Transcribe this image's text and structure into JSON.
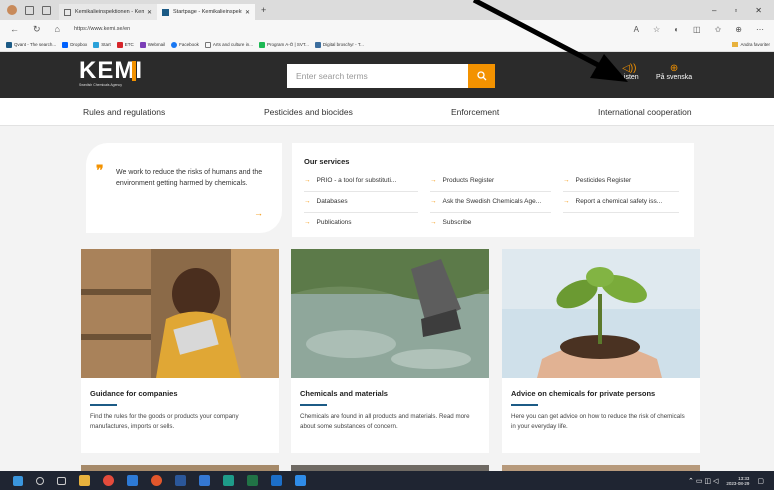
{
  "browser": {
    "tabs": [
      {
        "title": "Kemikalieinspektionen - Kemikal",
        "active": false
      },
      {
        "title": "Startpage - Kemikalieinspektion",
        "active": true
      }
    ],
    "url": "https://www.kemi.se/en",
    "favorites": [
      "Qvant - The search...",
      "Dropbox",
      "Start",
      "ETC",
      "Webmail",
      "Facebook",
      "Arts and culture in...",
      "Program A-Ö | SVT...",
      "Digital broschyr - T..."
    ],
    "favorites_other": "Andra favoriter"
  },
  "header": {
    "logo": "KEMI",
    "logo_sub": "Swedish Chemicals Agency",
    "search_placeholder": "Enter search terms",
    "listen_label": "Listen",
    "language_label": "På svenska"
  },
  "nav": [
    "Rules and regulations",
    "Pesticides and biocides",
    "Enforcement",
    "International cooperation"
  ],
  "intro": {
    "text": "We work to reduce the risks of humans and the environment getting harmed by chemicals."
  },
  "services": {
    "title": "Our services",
    "items": [
      "PRIO - a tool for substituti...",
      "Products Register",
      "Pesticides Register",
      "Databases",
      "Ask the Swedish Chemicals Age...",
      "Report a chemical safety iss...",
      "Publications",
      "Subscribe"
    ]
  },
  "cards": [
    {
      "title": "Guidance for companies",
      "desc": "Find the rules for the goods or products your company manufactures, imports or sells."
    },
    {
      "title": "Chemicals and materials",
      "desc": "Chemicals are found in all products and materials. Read more about some substances of concern."
    },
    {
      "title": "Advice on chemicals for private persons",
      "desc": "Here you can get advice on how to reduce the risk of chemicals in your everyday life."
    }
  ],
  "taskbar": {
    "time": "13:33",
    "date": "2023-08-29"
  },
  "colors": {
    "accent": "#f39200",
    "header_bg": "#2b2b2b",
    "card_underline": "#1c5b86"
  }
}
